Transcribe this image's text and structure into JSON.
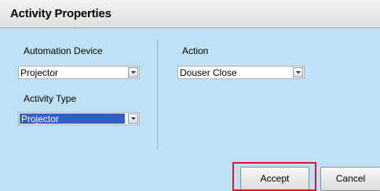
{
  "dialog": {
    "title": "Activity Properties"
  },
  "fields": {
    "automation_device": {
      "label": "Automation Device",
      "value": "Projector"
    },
    "activity_type": {
      "label": "Activity Type",
      "value": "Projector"
    },
    "action": {
      "label": "Action",
      "value": "Douser Close"
    }
  },
  "buttons": {
    "accept": "Accept",
    "cancel": "Cancel"
  },
  "colors": {
    "panel_bg": "#bfe1f6",
    "selection": "#3160c5",
    "highlight_box": "#e0121b"
  }
}
